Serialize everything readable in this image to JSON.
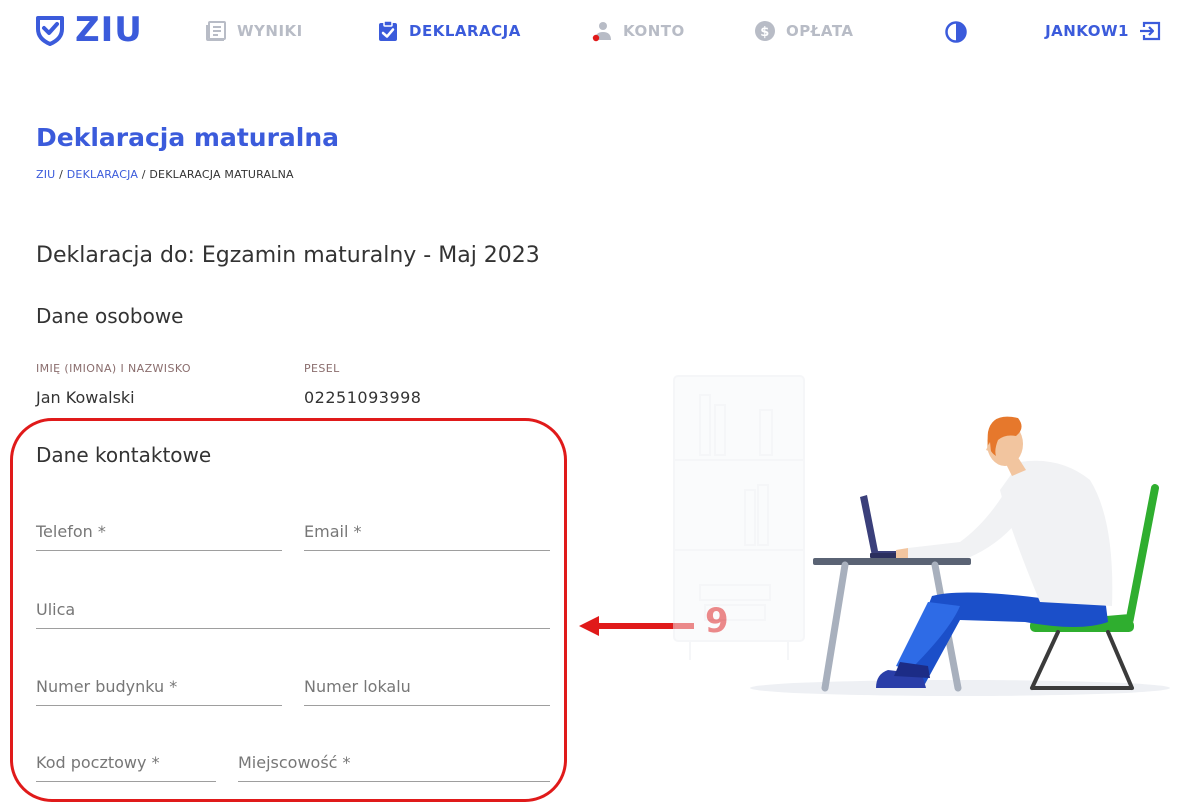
{
  "nav": {
    "logo": "ZIU",
    "items": [
      {
        "label": "WYNIKI",
        "icon": "newspaper-icon",
        "active": false
      },
      {
        "label": "DEKLARACJA",
        "icon": "clipboard-check-icon",
        "active": true
      },
      {
        "label": "KONTO",
        "icon": "user-icon",
        "active": false
      },
      {
        "label": "OPŁATA",
        "icon": "dollar-coin-icon",
        "active": false
      }
    ],
    "contrast_icon": "contrast-icon",
    "username": "JANKOW1",
    "logout_icon": "logout-icon"
  },
  "page": {
    "title": "Deklaracja maturalna",
    "breadcrumb": [
      "ZIU",
      "DEKLARACJA",
      "DEKLARACJA MATURALNA"
    ],
    "declaration_for": "Deklaracja do: Egzamin maturalny - Maj 2023"
  },
  "personal": {
    "title": "Dane osobowe",
    "name_label": "IMIĘ (IMIONA) I NAZWISKO",
    "name_value": "Jan Kowalski",
    "pesel_label": "PESEL",
    "pesel_value": "02251093998"
  },
  "contact": {
    "title": "Dane kontaktowe",
    "fields": {
      "telefon": "Telefon *",
      "email": "Email *",
      "ulica": "Ulica",
      "numer_budynku": "Numer budynku *",
      "numer_lokalu": "Numer lokalu",
      "kod_pocztowy": "Kod pocztowy *",
      "miejscowosc": "Miejscowość *"
    }
  },
  "annotation": {
    "number": "9",
    "color": "#e01a1a"
  },
  "colors": {
    "brand": "#3b5bdb",
    "muted_nav": "#b8bcc6"
  }
}
